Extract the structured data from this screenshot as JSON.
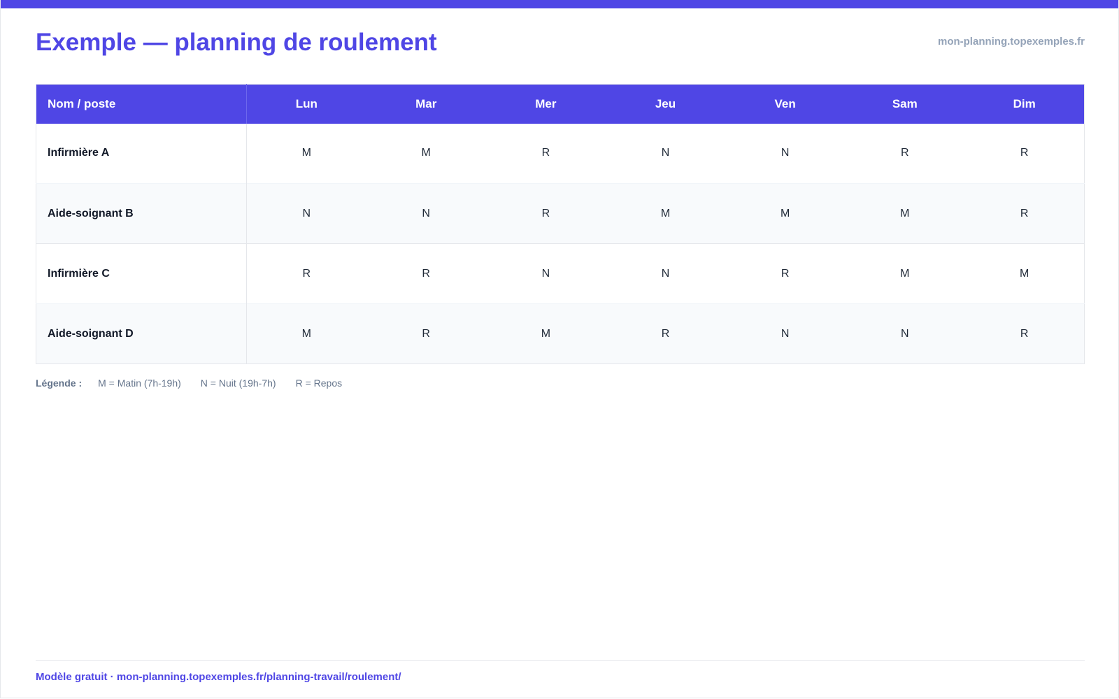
{
  "header": {
    "title": "Exemple — planning de roulement",
    "site": "mon-planning.topexemples.fr"
  },
  "colors": {
    "accent": "#4f46e5",
    "muted": "#94a3b8",
    "row_alt": "#f8fafc"
  },
  "table": {
    "name_header": "Nom / poste",
    "days": [
      "Lun",
      "Mar",
      "Mer",
      "Jeu",
      "Ven",
      "Sam",
      "Dim"
    ],
    "rows": [
      {
        "name": "Infirmière A",
        "shifts": [
          "M",
          "M",
          "R",
          "N",
          "N",
          "R",
          "R"
        ]
      },
      {
        "name": "Aide-soignant B",
        "shifts": [
          "N",
          "N",
          "R",
          "M",
          "M",
          "M",
          "R"
        ]
      },
      {
        "name": "Infirmière C",
        "shifts": [
          "R",
          "R",
          "N",
          "N",
          "R",
          "M",
          "M"
        ]
      },
      {
        "name": "Aide-soignant D",
        "shifts": [
          "M",
          "R",
          "M",
          "R",
          "N",
          "N",
          "R"
        ]
      }
    ]
  },
  "legend": {
    "title": "Légende :",
    "items": [
      "M = Matin (7h-19h)",
      "N = Nuit (19h-7h)",
      "R = Repos"
    ]
  },
  "footer": {
    "text": "Modèle gratuit · mon-planning.topexemples.fr/planning-travail/roulement/"
  }
}
